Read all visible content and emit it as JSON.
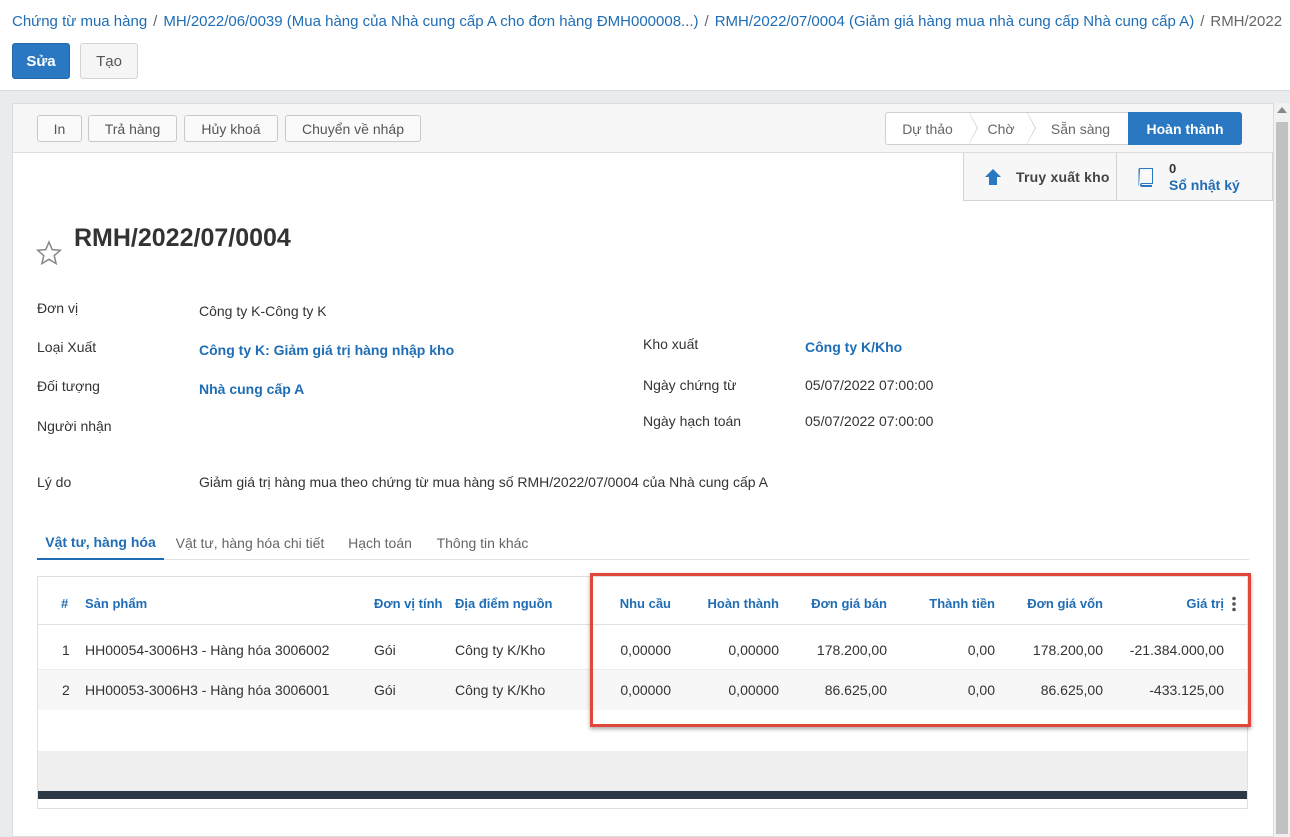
{
  "breadcrumb": [
    {
      "label": "Chứng từ mua hàng"
    },
    {
      "label": "MH/2022/06/0039 (Mua hàng của Nhà cung cấp A cho đơn hàng ĐMH000008...)"
    },
    {
      "label": "RMH/2022/07/0004 (Giảm giá hàng mua nhà cung cấp Nhà cung cấp A)"
    },
    {
      "label": "RMH/2022"
    }
  ],
  "actions": {
    "edit": "Sửa",
    "create": "Tạo"
  },
  "status_buttons": {
    "print": "In",
    "return": "Trả hàng",
    "unlock": "Hủy khoá",
    "to_draft": "Chuyển về nháp"
  },
  "stages": [
    "Dự thảo",
    "Chờ",
    "Sẵn sàng",
    "Hoàn thành"
  ],
  "smart_buttons": {
    "trace": "Truy xuất kho",
    "journal_count": "0",
    "journal": "Sổ nhật ký"
  },
  "record": {
    "title": "RMH/2022/07/0004"
  },
  "fields": {
    "unit_label": "Đơn vị",
    "unit_value": "Công ty K-Công ty K",
    "export_type_label": "Loại Xuất",
    "export_type_value": "Công ty K: Giảm giá trị hàng nhập kho",
    "partner_label": "Đối tượng",
    "partner_value": "Nhà cung cấp A",
    "receiver_label": "Người nhận",
    "warehouse_label": "Kho xuất",
    "warehouse_value": "Công ty K/Kho",
    "doc_date_label": "Ngày chứng từ",
    "doc_date_value": "05/07/2022 07:00:00",
    "acc_date_label": "Ngày hạch toán",
    "acc_date_value": "05/07/2022 07:00:00",
    "reason_label": "Lý do",
    "reason_value": "Giảm giá trị hàng mua theo chứng từ mua hàng số RMH/2022/07/0004 của Nhà cung cấp A"
  },
  "tabs": [
    "Vật tư, hàng hóa",
    "Vật tư, hàng hóa chi tiết",
    "Hạch toán",
    "Thông tin khác"
  ],
  "table": {
    "columns": [
      "#",
      "Sản phẩm",
      "Đơn vị tính",
      "Địa điểm nguồn",
      "Nhu cầu",
      "Hoàn thành",
      "Đơn giá bán",
      "Thành tiền",
      "Đơn giá vốn",
      "Giá trị"
    ],
    "rows": [
      [
        "1",
        "HH00054-3006H3 - Hàng hóa 3006002",
        "Gói",
        "Công ty K/Kho",
        "0,00000",
        "0,00000",
        "178.200,00",
        "0,00",
        "178.200,00",
        "-21.384.000,00"
      ],
      [
        "2",
        "HH00053-3006H3 - Hàng hóa 3006001",
        "Gói",
        "Công ty K/Kho",
        "0,00000",
        "0,00000",
        "86.625,00",
        "0,00",
        "86.625,00",
        "-433.125,00"
      ]
    ]
  },
  "colors": {
    "primary": "#2a78c2",
    "link": "#1f6db5",
    "highlight": "#e0473a"
  }
}
